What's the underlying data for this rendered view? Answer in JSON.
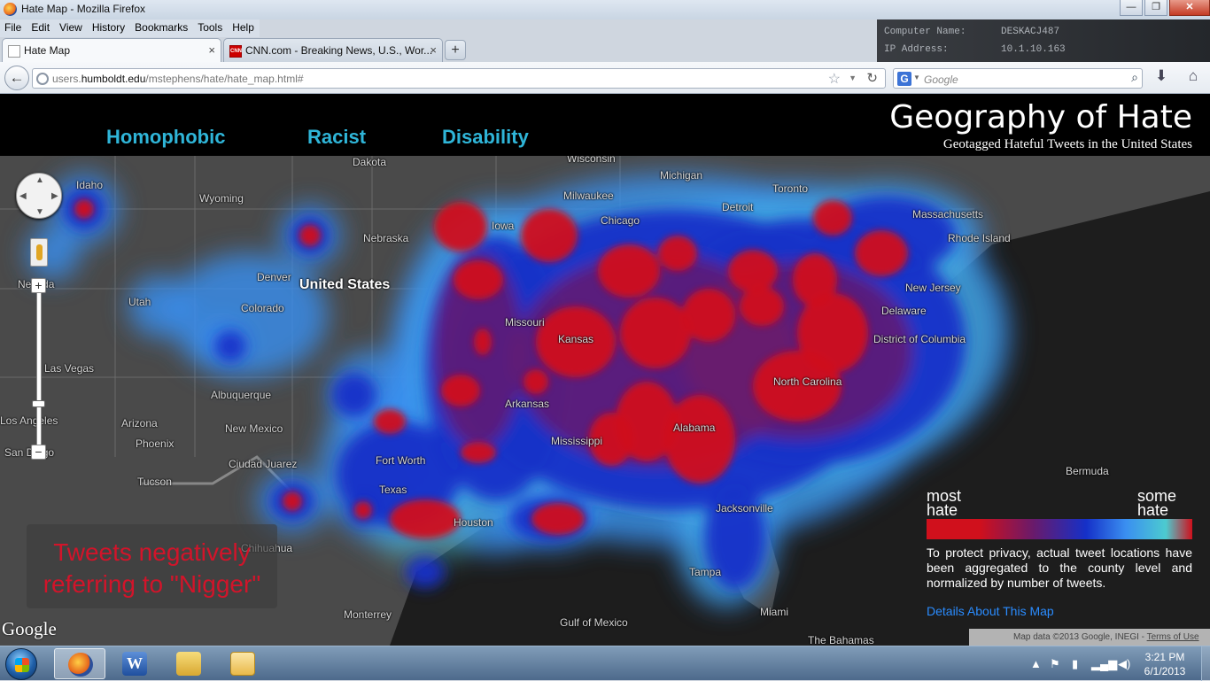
{
  "window": {
    "title": "Hate Map - Mozilla Firefox",
    "controls": {
      "minimize": "—",
      "maximize": "❐",
      "close": "✕"
    }
  },
  "desktop_bleed": {
    "row1_label": "Computer Name:",
    "row1_value": "DESKACJ487",
    "row2_label": "IP Address:",
    "row2_value": "10.1.10.163"
  },
  "menubar": [
    "File",
    "Edit",
    "View",
    "History",
    "Bookmarks",
    "Tools",
    "Help"
  ],
  "tabs": [
    {
      "label": "Hate Map",
      "close": "×"
    },
    {
      "label": "CNN.com - Breaking News, U.S., Wor...",
      "close": "×",
      "favicon": "CNN"
    }
  ],
  "newtab_label": "+",
  "navbar": {
    "back": "←",
    "url_prefix": "users.",
    "url_domain": "humboldt.edu",
    "url_path": "/mstephens/hate/hate_map.html#",
    "search_placeholder": "Google",
    "search_engine_icon": "G"
  },
  "site": {
    "nav": [
      "Homophobic",
      "Racist",
      "Disability"
    ],
    "title": "Geography of Hate",
    "subtitle": "Geotagged Hateful Tweets in the United States"
  },
  "map": {
    "labels": [
      "Dakota",
      "Wisconsin",
      "Michigan",
      "Toronto",
      "Idaho",
      "Wyoming",
      "Nebraska",
      "Iowa",
      "Milwaukee",
      "Chicago",
      "Detroit",
      "Massachusetts",
      "Rhode Island",
      "Nevada",
      "United States",
      "Utah",
      "Denver",
      "Colorado",
      "Missouri",
      "New Jersey",
      "Delaware",
      "Las Vegas",
      "Kansas",
      "District of Columbia",
      "Los Angeles",
      "Arizona",
      "Albuquerque",
      "New Mexico",
      "Arkansas",
      "North Carolina",
      "Phoenix",
      "Mississippi",
      "Alabama",
      "San Diego",
      "Fort Worth",
      "Texas",
      "Tucson",
      "Ciudad Juarez",
      "Bermuda",
      "Jacksonville",
      "Houston",
      "Chihuahua",
      "Tampa",
      "Miami",
      "Monterrey",
      "Gulf of Mexico",
      "The Bahamas"
    ],
    "caption": "Tweets negatively referring to \"Nigger\"",
    "google_logo": "Google",
    "copyright": "Map data ©2013 Google, INEGI - ",
    "terms": "Terms of Use",
    "zoom_in": "+",
    "zoom_out": "−"
  },
  "legend": {
    "most_label": "most hate",
    "some_label": "some hate",
    "note": "To protect privacy, actual tweet locations have been aggregated to the county level and normalized by number of tweets.",
    "details_link": "Details About This Map",
    "colors": [
      "#d0101c",
      "#6a1a6a",
      "#1530c8",
      "#3a8ff0",
      "#4ccbd0"
    ]
  },
  "taskbar": {
    "apps": [
      "Firefox",
      "Word",
      "Explorer",
      "Tickets"
    ],
    "time": "3:21 PM",
    "date": "6/1/2013"
  }
}
